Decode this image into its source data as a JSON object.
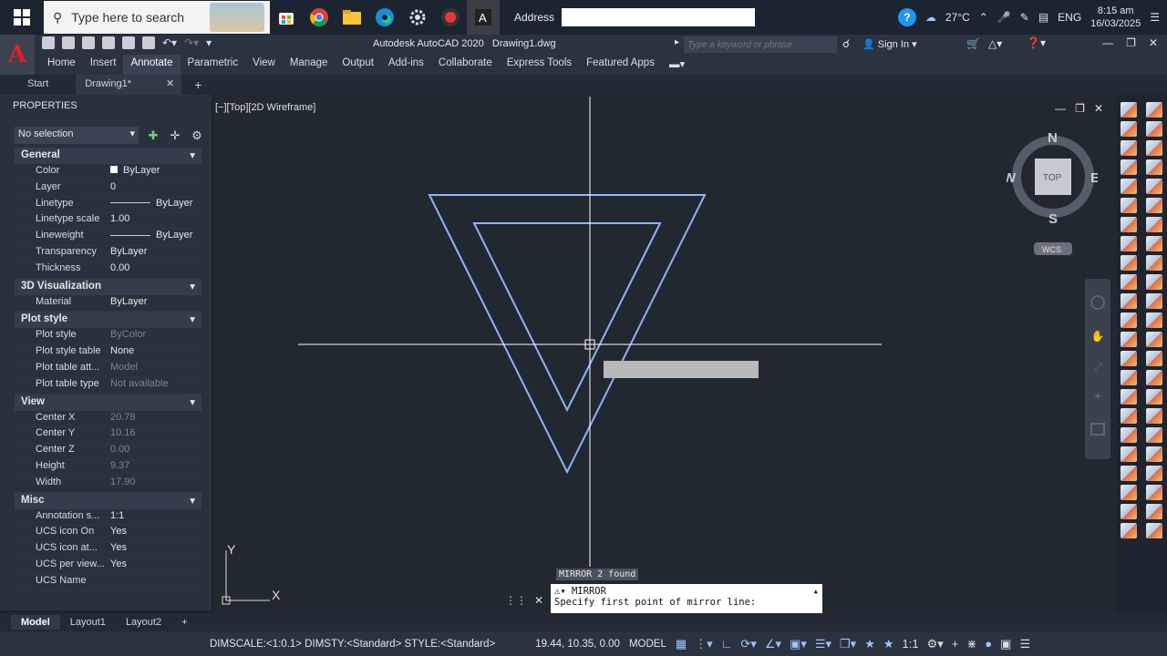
{
  "taskbar": {
    "search_placeholder": "Type here to search",
    "address_label": "Address",
    "address_value": "",
    "temperature": "27°C",
    "language": "ENG",
    "time": "8:15 am",
    "date": "16/03/2025"
  },
  "app": {
    "logo": "A",
    "title": "Autodesk AutoCAD 2020",
    "document": "Drawing1.dwg",
    "keyword_search_placeholder": "Type a keyword or phrase",
    "sign_in": "Sign In"
  },
  "ribbon": {
    "tabs": [
      "Home",
      "Insert",
      "Annotate",
      "Parametric",
      "View",
      "Manage",
      "Output",
      "Add-ins",
      "Collaborate",
      "Express Tools",
      "Featured Apps"
    ],
    "active_tab": "Annotate"
  },
  "doc_tabs": {
    "start": "Start",
    "active": "Drawing1*"
  },
  "properties": {
    "header": "PROPERTIES",
    "selection": "No selection",
    "sections": [
      {
        "title": "General",
        "rows": [
          {
            "key": "Color",
            "value": "ByLayer",
            "type": "color"
          },
          {
            "key": "Layer",
            "value": "0"
          },
          {
            "key": "Linetype",
            "value": "ByLayer",
            "type": "line"
          },
          {
            "key": "Linetype scale",
            "value": "1.00"
          },
          {
            "key": "Lineweight",
            "value": "ByLayer",
            "type": "line"
          },
          {
            "key": "Transparency",
            "value": "ByLayer"
          },
          {
            "key": "Thickness",
            "value": "0.00"
          }
        ]
      },
      {
        "title": "3D Visualization",
        "rows": [
          {
            "key": "Material",
            "value": "ByLayer"
          }
        ]
      },
      {
        "title": "Plot style",
        "rows": [
          {
            "key": "Plot style",
            "value": "ByColor",
            "dim": true
          },
          {
            "key": "Plot style table",
            "value": "None"
          },
          {
            "key": "Plot table att...",
            "value": "Model",
            "dim": true
          },
          {
            "key": "Plot table type",
            "value": "Not available",
            "dim": true
          }
        ]
      },
      {
        "title": "View",
        "rows": [
          {
            "key": "Center X",
            "value": "20.78",
            "dim": true
          },
          {
            "key": "Center Y",
            "value": "10.16",
            "dim": true
          },
          {
            "key": "Center Z",
            "value": "0.00",
            "dim": true
          },
          {
            "key": "Height",
            "value": "9.37",
            "dim": true
          },
          {
            "key": "Width",
            "value": "17.90",
            "dim": true
          }
        ]
      },
      {
        "title": "Misc",
        "rows": [
          {
            "key": "Annotation s...",
            "value": "1:1"
          },
          {
            "key": "UCS icon On",
            "value": "Yes"
          },
          {
            "key": "UCS icon at...",
            "value": "Yes"
          },
          {
            "key": "UCS per view...",
            "value": "Yes"
          },
          {
            "key": "UCS Name",
            "value": ""
          }
        ]
      }
    ]
  },
  "viewport": {
    "label": "[−][Top][2D Wireframe]",
    "viewcube": {
      "n": "N",
      "s": "S",
      "e": "E",
      "w": "W",
      "face": "TOP",
      "ucs": "WCS"
    },
    "ucs_x": "X",
    "ucs_y": "Y"
  },
  "command": {
    "tooltip": "MIRROR 2 found",
    "name": "MIRROR",
    "prompt": "Specify first point of mirror line:"
  },
  "layout_tabs": [
    "Model",
    "Layout1",
    "Layout2"
  ],
  "status": {
    "dimscale": "DIMSCALE:<1:0.1> DIMSTY:<Standard> STYLE:<Standard>",
    "coords": "19.44, 10.35, 0.00",
    "model": "MODEL",
    "scale": "1:1"
  },
  "colors": {
    "drawing_lines": "#8fb4f5",
    "crosshair": "#ffffff",
    "canvas": "#212830"
  }
}
